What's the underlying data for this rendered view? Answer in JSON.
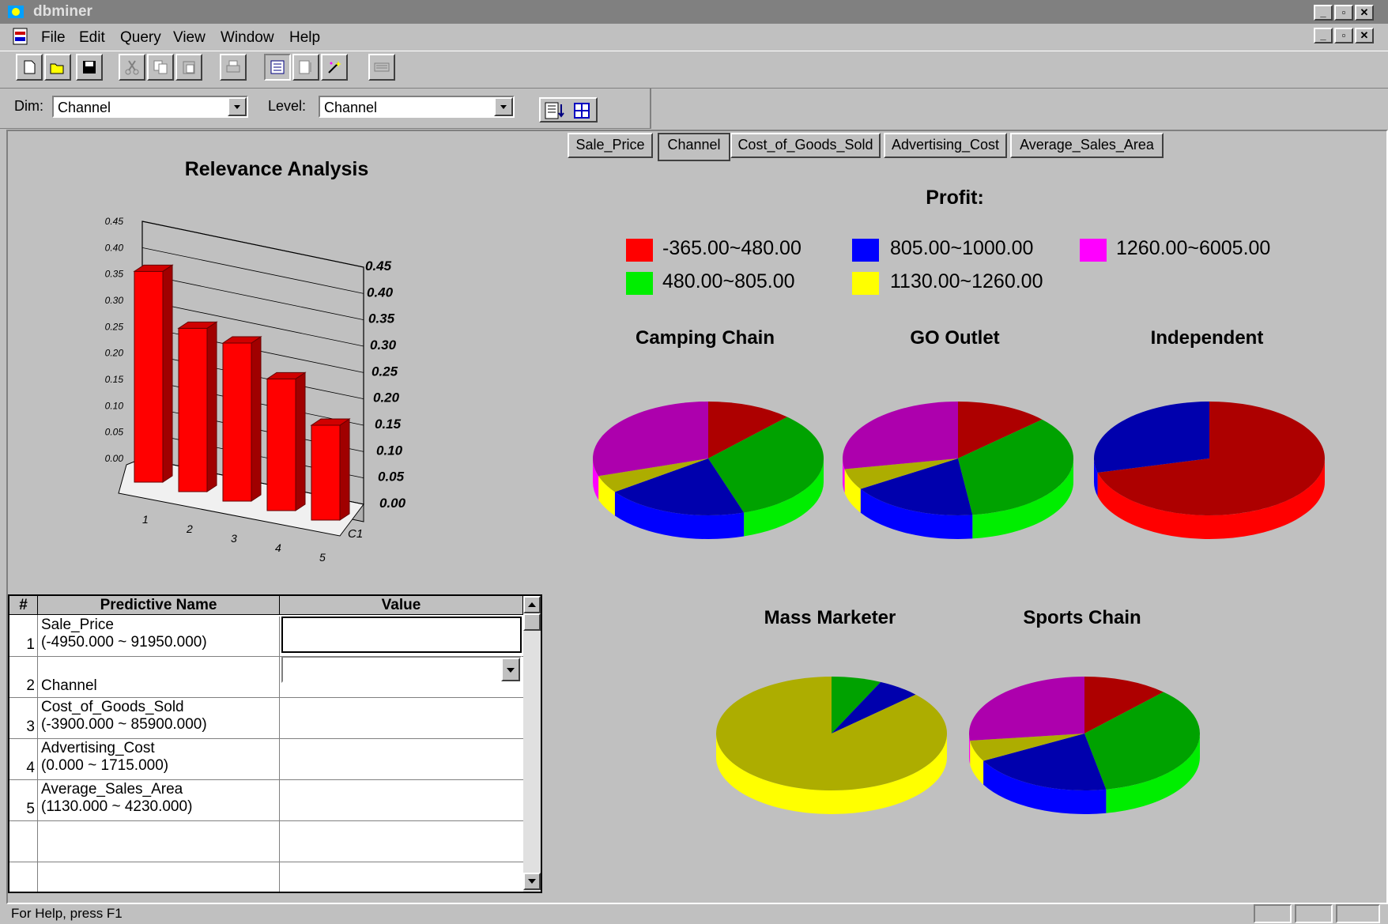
{
  "window": {
    "title": "dbminer"
  },
  "menu": {
    "items": [
      "File",
      "Edit",
      "Query",
      "View",
      "Window",
      "Help"
    ]
  },
  "toolbar": {
    "icons": [
      "new-icon",
      "open-icon",
      "save-icon",
      "cut-icon",
      "copy-icon",
      "paste-icon",
      "print-icon",
      "table-view-icon",
      "list-view-icon",
      "wizard-icon",
      "keyboard-icon"
    ]
  },
  "dimbar": {
    "dim_label": "Dim:",
    "dim_value": "Channel",
    "level_label": "Level:",
    "level_value": "Channel"
  },
  "tabs": [
    "Sale_Price",
    "Channel",
    "Cost_of_Goods_Sold",
    "Advertising_Cost",
    "Average_Sales_Area"
  ],
  "active_tab": "Channel",
  "colors": {
    "red": "#ff0000",
    "green": "#00ee00",
    "blue": "#0000ff",
    "yellow": "#ffff00",
    "magenta": "#ff00ff",
    "dark_yellow": "#aaaa00"
  },
  "chart_data": [
    {
      "type": "bar",
      "title": "Relevance Analysis",
      "categories": [
        "1",
        "2",
        "3",
        "4",
        "5"
      ],
      "values": [
        0.4,
        0.31,
        0.3,
        0.25,
        0.18
      ],
      "ylim": [
        0,
        0.45
      ],
      "ytick_labels": [
        "0.00",
        "0.05",
        "0.10",
        "0.15",
        "0.20",
        "0.25",
        "0.30",
        "0.35",
        "0.40",
        "0.45"
      ],
      "right_tick_labels": [
        "0.00",
        "0.05",
        "0.10",
        "0.15",
        "0.20",
        "0.25",
        "0.30",
        "0.35",
        "0.40",
        "0.45"
      ],
      "depth_label": "C1",
      "style": "3d",
      "grid": true
    },
    {
      "type": "pie",
      "title": "Profit:",
      "legend": [
        {
          "label": "-365.00~480.00",
          "color": "#ff0000"
        },
        {
          "label": "805.00~1000.00",
          "color": "#0000ff"
        },
        {
          "label": "1260.00~6005.00",
          "color": "#ff00ff"
        },
        {
          "label": "480.00~805.00",
          "color": "#00ee00"
        },
        {
          "label": "1130.00~1260.00",
          "color": "#ffff00"
        }
      ],
      "pies": [
        {
          "name": "Camping Chain",
          "slices": [
            {
              "label": "-365.00~480.00",
              "value": 12,
              "color": "#ff0000"
            },
            {
              "label": "480.00~805.00",
              "value": 33,
              "color": "#00ee00"
            },
            {
              "label": "805.00~1000.00",
              "value": 20,
              "color": "#0000ff"
            },
            {
              "label": "1130.00~1260.00",
              "value": 5,
              "color": "#ffff00"
            },
            {
              "label": "1260.00~6005.00",
              "value": 30,
              "color": "#ff00ff"
            }
          ]
        },
        {
          "name": "GO Outlet",
          "slices": [
            {
              "label": "-365.00~480.00",
              "value": 13,
              "color": "#ff0000"
            },
            {
              "label": "480.00~805.00",
              "value": 35,
              "color": "#00ee00"
            },
            {
              "label": "805.00~1000.00",
              "value": 18,
              "color": "#0000ff"
            },
            {
              "label": "1130.00~1260.00",
              "value": 6,
              "color": "#ffff00"
            },
            {
              "label": "1260.00~6005.00",
              "value": 28,
              "color": "#ff00ff"
            }
          ]
        },
        {
          "name": "Independent",
          "slices": [
            {
              "label": "-365.00~480.00",
              "value": 71,
              "color": "#ff0000"
            },
            {
              "label": "805.00~1000.00",
              "value": 29,
              "color": "#0000ff"
            }
          ]
        },
        {
          "name": "Mass Marketer",
          "slices": [
            {
              "label": "480.00~805.00",
              "value": 7,
              "color": "#00ee00"
            },
            {
              "label": "805.00~1000.00",
              "value": 6,
              "color": "#0000ff"
            },
            {
              "label": "1130.00~1260.00",
              "value": 87,
              "color": "#ffff00"
            }
          ]
        },
        {
          "name": "Sports Chain",
          "slices": [
            {
              "label": "-365.00~480.00",
              "value": 12,
              "color": "#ff0000"
            },
            {
              "label": "480.00~805.00",
              "value": 35,
              "color": "#00ee00"
            },
            {
              "label": "805.00~1000.00",
              "value": 20,
              "color": "#0000ff"
            },
            {
              "label": "1130.00~1260.00",
              "value": 6,
              "color": "#ffff00"
            },
            {
              "label": "1260.00~6005.00",
              "value": 27,
              "color": "#ff00ff"
            }
          ]
        }
      ]
    }
  ],
  "grid": {
    "headers": [
      "#",
      "Predictive Name",
      "Value"
    ],
    "rows": [
      {
        "num": "1",
        "name": "Sale_Price",
        "range": "(-4950.000 ~ 91950.000)"
      },
      {
        "num": "2",
        "name": "Channel",
        "range": ""
      },
      {
        "num": "3",
        "name": "Cost_of_Goods_Sold",
        "range": "(-3900.000 ~ 85900.000)"
      },
      {
        "num": "4",
        "name": "Advertising_Cost",
        "range": "(0.000 ~ 1715.000)"
      },
      {
        "num": "5",
        "name": "Average_Sales_Area",
        "range": "(1130.000 ~ 4230.000)"
      }
    ]
  },
  "status": {
    "text": "For Help, press F1"
  }
}
